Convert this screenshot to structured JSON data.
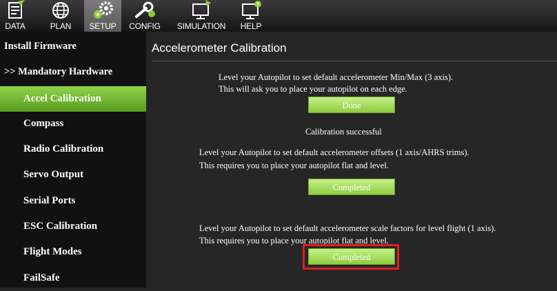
{
  "toolbar": {
    "items": [
      {
        "label": "DATA",
        "icon": "data-icon"
      },
      {
        "label": "PLAN",
        "icon": "globe-icon"
      },
      {
        "label": "SETUP",
        "icon": "gears-icon"
      },
      {
        "label": "CONFIG",
        "icon": "wrench-icon"
      },
      {
        "label": "SIMULATION",
        "icon": "monitor-plane-icon"
      },
      {
        "label": "HELP",
        "icon": "monitor-help-icon"
      }
    ]
  },
  "sidebar": {
    "items": [
      {
        "label": "Install Firmware"
      },
      {
        "label": ">> Mandatory Hardware"
      },
      {
        "label": "Accel Calibration"
      },
      {
        "label": "Compass"
      },
      {
        "label": "Radio Calibration"
      },
      {
        "label": "Servo Output"
      },
      {
        "label": "Serial Ports"
      },
      {
        "label": "ESC Calibration"
      },
      {
        "label": "Flight Modes"
      },
      {
        "label": "FailSafe"
      }
    ]
  },
  "main": {
    "title": "Accelerometer Calibration",
    "section1": {
      "line1": "Level your Autopilot to set default accelerometer Min/Max (3 axis).",
      "line2": "This will ask you to place your autopilot on each edge.",
      "button": "Done",
      "status": "Calibration successful"
    },
    "section2": {
      "line1": "Level your Autopilot to set default accelerometer offsets (1 axis/AHRS trims).",
      "line2": "This requires you to place your autopilot flat and level.",
      "button": "Completed"
    },
    "section3": {
      "line1": "Level your Autopilot to set default accelerometer scale factors for level flight (1 axis).",
      "line2": "This requires you to place your autopilot flat and level.",
      "button": "Completed"
    }
  },
  "colors": {
    "accent": "#8ccd3c",
    "highlight": "#e02020"
  }
}
